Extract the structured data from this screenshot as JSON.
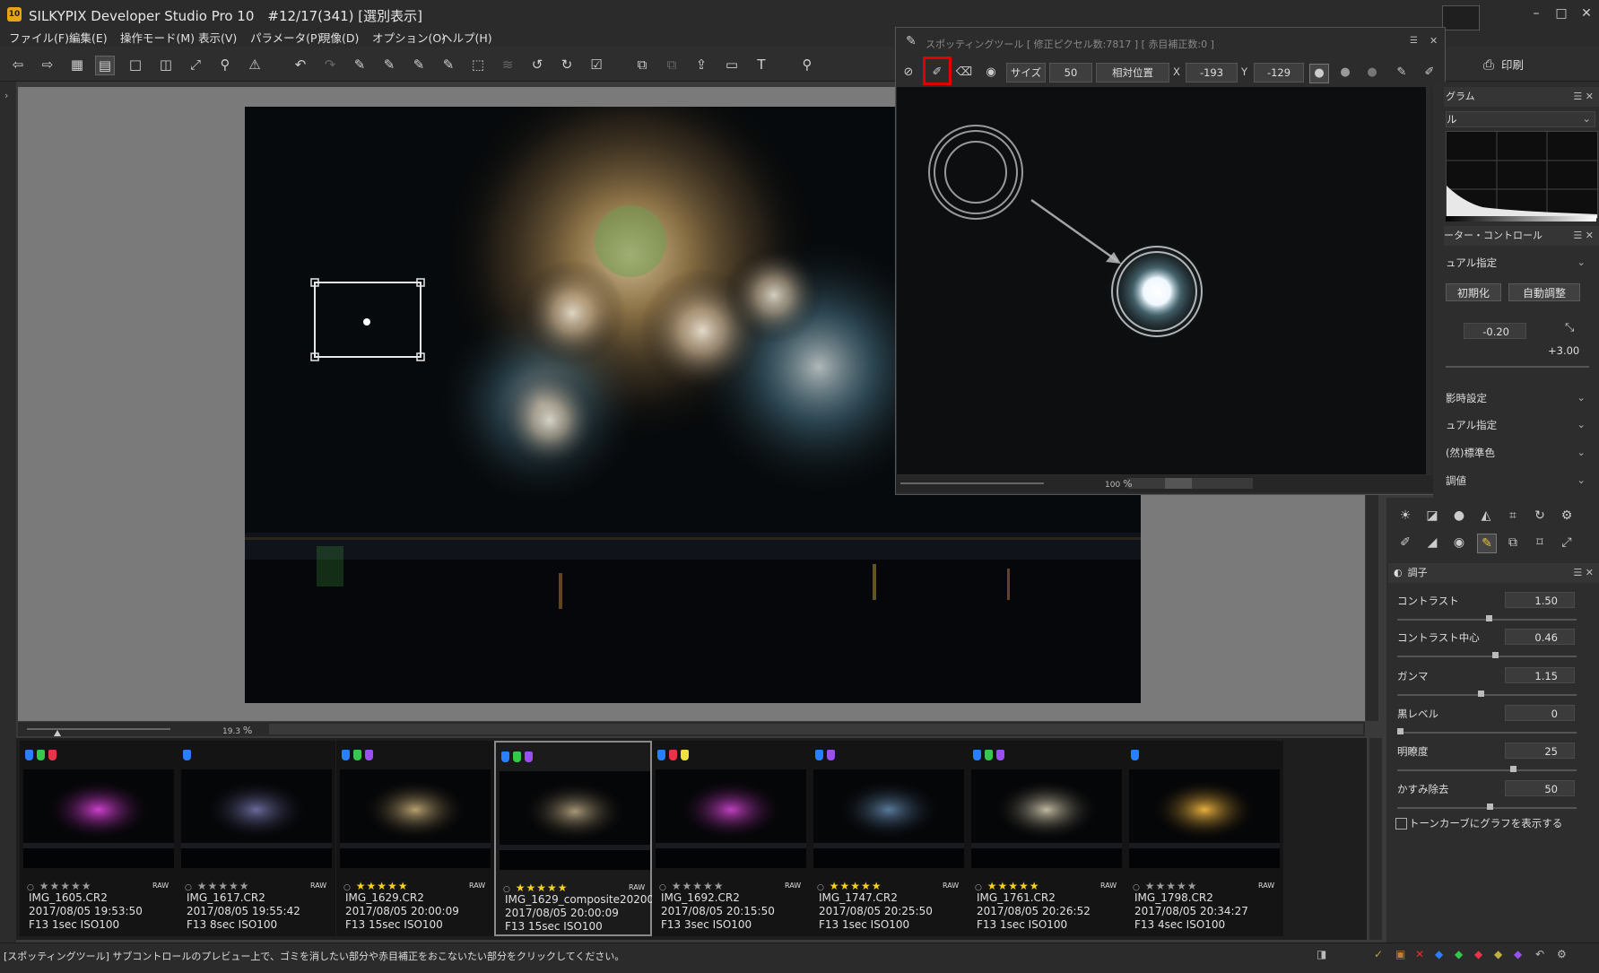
{
  "window": {
    "title": "SILKYPIX Developer Studio Pro 10　#12/17(341) [選別表示]",
    "app_icon": "10",
    "minimize": "–",
    "maximize": "□",
    "close": "✕"
  },
  "menu": [
    {
      "label": "ファイル(F)"
    },
    {
      "label": "編集(E)"
    },
    {
      "label": "操作モード(M)"
    },
    {
      "label": "表示(V)"
    },
    {
      "label": "パラメータ(P)"
    },
    {
      "label": "現像(D)"
    },
    {
      "label": "オプション(O)"
    },
    {
      "label": "ヘルプ(H)"
    }
  ],
  "toolbar": {
    "print_label": "印刷"
  },
  "preview": {
    "zoom": "19.3",
    "zoom_unit": "%"
  },
  "spotting": {
    "title": "スポッティングツール [ 修正ピクセル数:7817 ] [ 赤目補正数:0 ]",
    "size_label": "サイズ",
    "size_value": "50",
    "position_label": "相対位置",
    "x_label": "X",
    "x_value": "-193",
    "y_label": "Y",
    "y_value": "-129",
    "zoom": "100",
    "zoom_unit": "%"
  },
  "right_panel": {
    "histogram_title": "グラム",
    "histogram_select": "ル",
    "param_title": "ーター・コントロール",
    "param_select": "ュアル指定",
    "reset_button": "初期化",
    "auto_button": "自動調整",
    "exposure_value": "-0.20",
    "exposure_max": "+3.00",
    "wb_select": "影時設定",
    "tone_select": "ュアル指定",
    "color_select": "(然)標準色",
    "sharp_select": "調値",
    "adjust_title": "調子",
    "contrast_label": "コントラスト",
    "contrast_value": "1.50",
    "contrast_center_label": "コントラスト中心",
    "contrast_center_value": "0.46",
    "gamma_label": "ガンマ",
    "gamma_value": "1.15",
    "black_label": "黒レベル",
    "black_value": "0",
    "clarity_label": "明瞭度",
    "clarity_value": "25",
    "dehaze_label": "かすみ除去",
    "dehaze_value": "50",
    "tonecurve_label": "トーンカーブにグラフを表示する"
  },
  "filmstrip": [
    {
      "name": "IMG_1605.CR2",
      "date": "2017/08/05 19:53:50",
      "exposure": "F13 1sec ISO100",
      "stars": 0,
      "raw": "RAW",
      "tags": [
        "#2a7fff",
        "#34c94a",
        "#e8334a"
      ],
      "img_color": "#d040d0"
    },
    {
      "name": "IMG_1617.CR2",
      "date": "2017/08/05 19:55:42",
      "exposure": "F13 8sec ISO100",
      "stars": 0,
      "raw": "RAW",
      "tags": [
        "#2a7fff"
      ],
      "img_color": "#6a6a9a"
    },
    {
      "name": "IMG_1629.CR2",
      "date": "2017/08/05 20:00:09",
      "exposure": "F13 15sec ISO100",
      "stars": 5,
      "raw": "RAW",
      "tags": [
        "#2a7fff",
        "#34c94a",
        "#9a4ff0"
      ],
      "img_color": "#b8a070"
    },
    {
      "name": "IMG_1629_composite20200",
      "date": "2017/08/05 20:00:09",
      "exposure": "F13 15sec ISO100",
      "stars": 5,
      "raw": "RAW",
      "tags": [
        "#2a7fff",
        "#34c94a",
        "#9a4ff0"
      ],
      "img_color": "#a89878"
    },
    {
      "name": "IMG_1692.CR2",
      "date": "2017/08/05 20:15:50",
      "exposure": "F13 3sec ISO100",
      "stars": 0,
      "raw": "RAW",
      "tags": [
        "#2a7fff",
        "#e8334a",
        "#f0e040"
      ],
      "img_color": "#c040c0"
    },
    {
      "name": "IMG_1747.CR2",
      "date": "2017/08/05 20:25:50",
      "exposure": "F13 1sec ISO100",
      "stars": 5,
      "raw": "RAW",
      "tags": [
        "#2a7fff",
        "#9a4ff0"
      ],
      "img_color": "#5a7a9a"
    },
    {
      "name": "IMG_1761.CR2",
      "date": "2017/08/05 20:26:52",
      "exposure": "F13 1sec ISO100",
      "stars": 5,
      "raw": "RAW",
      "tags": [
        "#2a7fff",
        "#34c94a",
        "#9a4ff0"
      ],
      "img_color": "#c0b8a0"
    },
    {
      "name": "IMG_1798.CR2",
      "date": "2017/08/05 20:34:27",
      "exposure": "F13 4sec ISO100",
      "stars": 0,
      "raw": "RAW",
      "tags": [
        "#2a7fff"
      ],
      "img_color": "#e8b040"
    }
  ],
  "status": {
    "message": "[スポッティングツール] サブコントロールのプレビュー上で、ゴミを消したい部分や赤目補正をおこないたい部分をクリックしてください。"
  },
  "colors": {
    "highlight": "#e00000",
    "star_on": "#f5d21c",
    "star_off": "#9a9a9a"
  }
}
